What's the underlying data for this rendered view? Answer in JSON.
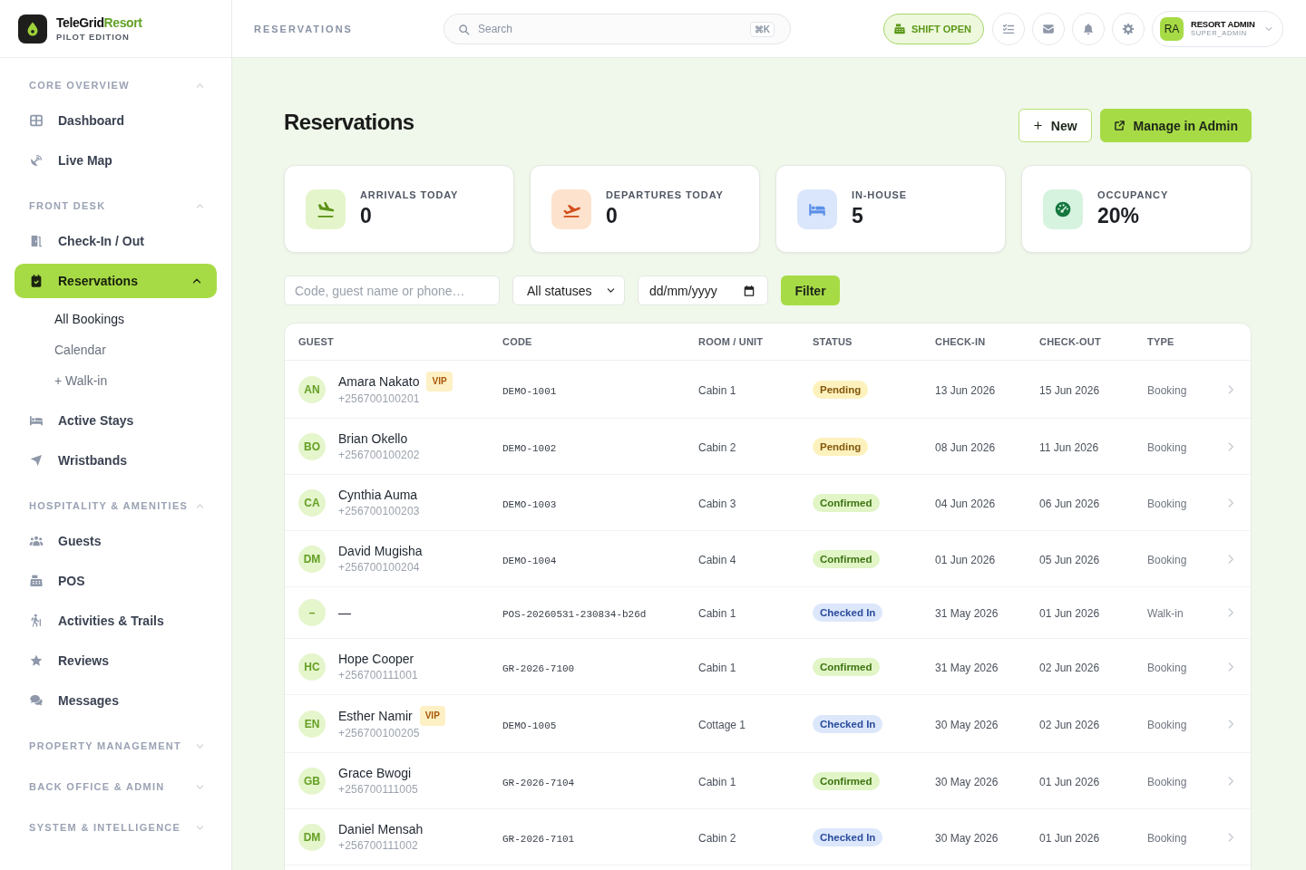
{
  "brand": {
    "name": "TeleGrid",
    "name_accent": "Resort",
    "edition": "PILOT EDITION"
  },
  "sidebar": {
    "sections": [
      {
        "title": "CORE OVERVIEW",
        "expanded": true,
        "items": [
          {
            "label": "Dashboard",
            "selected": false
          },
          {
            "label": "Live Map",
            "selected": false
          }
        ]
      },
      {
        "title": "FRONT DESK",
        "expanded": true,
        "items": [
          {
            "label": "Check-In / Out",
            "selected": false
          },
          {
            "label": "Reservations",
            "selected": true,
            "expanded": true,
            "children": [
              {
                "label": "All Bookings",
                "selected": true
              },
              {
                "label": "Calendar",
                "selected": false
              },
              {
                "label": "+ Walk-in",
                "selected": false
              }
            ]
          },
          {
            "label": "Active Stays",
            "selected": false
          },
          {
            "label": "Wristbands",
            "selected": false
          }
        ]
      },
      {
        "title": "HOSPITALITY & AMENITIES",
        "expanded": true,
        "items": [
          {
            "label": "Guests",
            "selected": false
          },
          {
            "label": "POS",
            "selected": false
          },
          {
            "label": "Activities & Trails",
            "selected": false
          },
          {
            "label": "Reviews",
            "selected": false
          },
          {
            "label": "Messages",
            "selected": false
          }
        ]
      },
      {
        "title": "PROPERTY MANAGEMENT",
        "expanded": false
      },
      {
        "title": "BACK OFFICE & ADMIN",
        "expanded": false
      },
      {
        "title": "SYSTEM & INTELLIGENCE",
        "expanded": false
      }
    ]
  },
  "topbar": {
    "breadcrumb": "RESERVATIONS",
    "search": {
      "placeholder": "Search",
      "shortcut": "⌘K"
    },
    "shift_status": "SHIFT OPEN",
    "user": {
      "initials": "RA",
      "name": "RESORT ADMIN",
      "role": "SUPER_ADMIN"
    }
  },
  "page": {
    "title": "Reservations",
    "actions": [
      {
        "label": "New",
        "kind": "secondary"
      },
      {
        "label": "Manage in Admin",
        "kind": "primary"
      }
    ]
  },
  "stats": [
    {
      "label": "ARRIVALS TODAY",
      "value": "0"
    },
    {
      "label": "DEPARTURES TODAY",
      "value": "0"
    },
    {
      "label": "IN-HOUSE",
      "value": "5"
    },
    {
      "label": "OCCUPANCY",
      "value": "20%"
    }
  ],
  "filters": {
    "search": {
      "placeholder": "Code, guest name or phone…"
    },
    "status_select": {
      "value": "All statuses"
    },
    "date": {
      "placeholder": "dd/mm/yyyy"
    },
    "button": "Filter"
  },
  "table": {
    "columns": [
      "GUEST",
      "CODE",
      "ROOM / UNIT",
      "STATUS",
      "CHECK-IN",
      "CHECK-OUT",
      "TYPE"
    ],
    "rows": [
      {
        "initials": "AN",
        "name": "Amara Nakato",
        "badge": "VIP",
        "phone": "+256700100201",
        "code": "DEMO-1001",
        "room": "Cabin 1",
        "status": {
          "label": "Pending",
          "kind": "pending"
        },
        "check_in": "13 Jun 2026",
        "check_out": "15 Jun 2026",
        "type": "Booking"
      },
      {
        "initials": "BO",
        "name": "Brian Okello",
        "phone": "+256700100202",
        "code": "DEMO-1002",
        "room": "Cabin 2",
        "status": {
          "label": "Pending",
          "kind": "pending"
        },
        "check_in": "08 Jun 2026",
        "check_out": "11 Jun 2026",
        "type": "Booking"
      },
      {
        "initials": "CA",
        "name": "Cynthia Auma",
        "phone": "+256700100203",
        "code": "DEMO-1003",
        "room": "Cabin 3",
        "status": {
          "label": "Confirmed",
          "kind": "confirmed"
        },
        "check_in": "04 Jun 2026",
        "check_out": "06 Jun 2026",
        "type": "Booking"
      },
      {
        "initials": "DM",
        "name": "David Mugisha",
        "phone": "+256700100204",
        "code": "DEMO-1004",
        "room": "Cabin 4",
        "status": {
          "label": "Confirmed",
          "kind": "confirmed"
        },
        "check_in": "01 Jun 2026",
        "check_out": "05 Jun 2026",
        "type": "Booking"
      },
      {
        "initials": "–",
        "name": "—",
        "code": "POS-20260531-230834-b26d",
        "room": "Cabin 1",
        "status": {
          "label": "Checked In",
          "kind": "checkedin"
        },
        "check_in": "31 May 2026",
        "check_out": "01 Jun 2026",
        "type": "Walk-in"
      },
      {
        "initials": "HC",
        "name": "Hope Cooper",
        "phone": "+256700111001",
        "code": "GR-2026-7100",
        "room": "Cabin 1",
        "status": {
          "label": "Confirmed",
          "kind": "confirmed"
        },
        "check_in": "31 May 2026",
        "check_out": "02 Jun 2026",
        "type": "Booking"
      },
      {
        "initials": "EN",
        "name": "Esther Namir",
        "badge": "VIP",
        "phone": "+256700100205",
        "code": "DEMO-1005",
        "room": "Cottage 1",
        "status": {
          "label": "Checked In",
          "kind": "checkedin"
        },
        "check_in": "30 May 2026",
        "check_out": "02 Jun 2026",
        "type": "Booking"
      },
      {
        "initials": "GB",
        "name": "Grace Bwogi",
        "phone": "+256700111005",
        "code": "GR-2026-7104",
        "room": "Cabin 1",
        "status": {
          "label": "Confirmed",
          "kind": "confirmed"
        },
        "check_in": "30 May 2026",
        "check_out": "01 Jun 2026",
        "type": "Booking"
      },
      {
        "initials": "DM",
        "name": "Daniel Mensah",
        "phone": "+256700111002",
        "code": "GR-2026-7101",
        "room": "Cabin 2",
        "status": {
          "label": "Checked In",
          "kind": "checkedin"
        },
        "check_in": "30 May 2026",
        "check_out": "01 Jun 2026",
        "type": "Booking"
      }
    ]
  }
}
